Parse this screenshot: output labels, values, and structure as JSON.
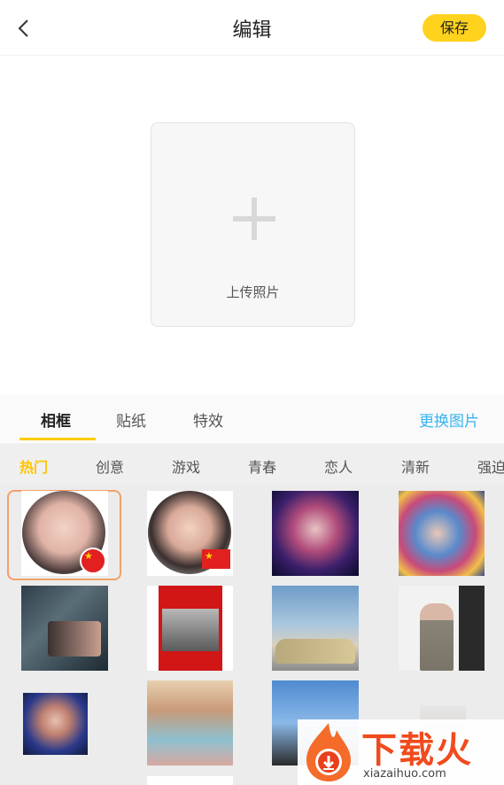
{
  "header": {
    "title": "编辑",
    "save_label": "保存"
  },
  "upload": {
    "label": "上传照片"
  },
  "tabs": [
    {
      "label": "相框",
      "active": true
    },
    {
      "label": "贴纸",
      "active": false
    },
    {
      "label": "特效",
      "active": false
    }
  ],
  "change_image_label": "更换图片",
  "categories": [
    {
      "label": "热门",
      "active": true
    },
    {
      "label": "创意"
    },
    {
      "label": "游戏"
    },
    {
      "label": "青春"
    },
    {
      "label": "恋人"
    },
    {
      "label": "清新"
    },
    {
      "label": "强迫"
    }
  ],
  "watermark": {
    "title": "下载火",
    "url": "xiazaihuo.com"
  },
  "colors": {
    "accent": "#ffd21e",
    "link": "#36b4f0",
    "selected_border": "#f3a06b"
  }
}
